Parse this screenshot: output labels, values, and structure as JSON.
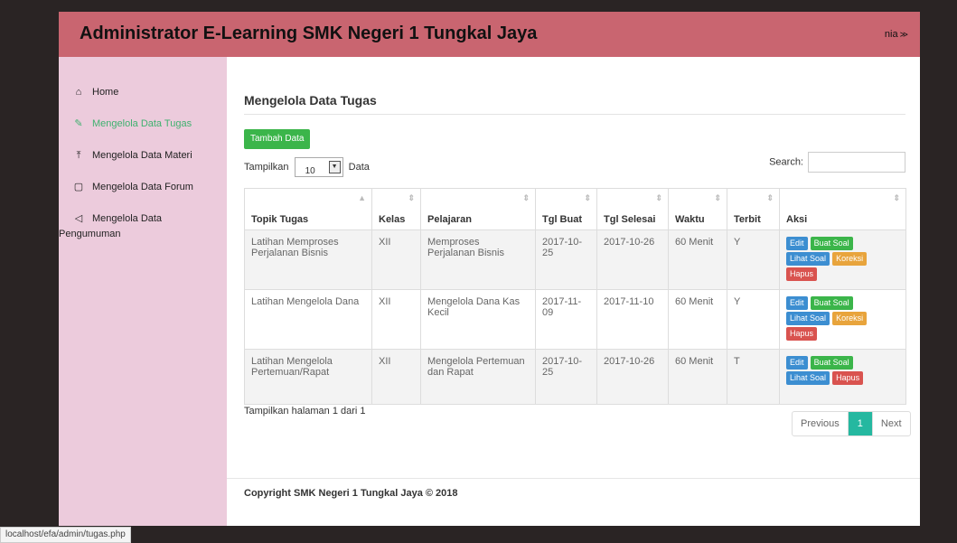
{
  "header": {
    "title": "Administrator E-Learning SMK Negeri 1 Tungkal Jaya",
    "user": "nia",
    "user_caret": "≫"
  },
  "sidebar": {
    "items": [
      {
        "label": "Home",
        "icon": "home-icon",
        "glyph": "⌂"
      },
      {
        "label": "Mengelola Data Tugas",
        "icon": "edit-icon",
        "glyph": "✎"
      },
      {
        "label": "Mengelola Data Materi",
        "icon": "upload-icon",
        "glyph": "⤒"
      },
      {
        "label": "Mengelola Data Forum",
        "icon": "chat-icon",
        "glyph": "▢"
      },
      {
        "label": "Mengelola Data",
        "label2": "Pengumuman",
        "icon": "bullhorn-icon",
        "glyph": "◁"
      }
    ]
  },
  "main": {
    "title": "Mengelola Data Tugas",
    "add_button": "Tambah Data",
    "length_prefix": "Tampilkan",
    "length_value": "10",
    "length_suffix": "Data",
    "search_label": "Search:",
    "search_value": "",
    "columns": [
      "Topik Tugas",
      "Kelas",
      "Pelajaran",
      "Tgl Buat",
      "Tgl Selesai",
      "Waktu",
      "Terbit",
      "Aksi"
    ],
    "rows": [
      {
        "topik": "Latihan Memproses Perjalanan Bisnis",
        "kelas": "XII",
        "pelajaran": "Memproses Perjalanan Bisnis",
        "tgl_buat": "2017-10-25",
        "tgl_selesai": "2017-10-26",
        "waktu": "60 Menit",
        "terbit": "Y",
        "aksi": [
          {
            "label": "Edit",
            "kind": "edit"
          },
          {
            "label": "Buat Soal",
            "kind": "buat"
          },
          {
            "label": "Lihat Soal",
            "kind": "lihat"
          },
          {
            "label": "Koreksi",
            "kind": "koreksi"
          },
          {
            "label": "Hapus",
            "kind": "hapus"
          }
        ]
      },
      {
        "topik": "Latihan Mengelola Dana",
        "kelas": "XII",
        "pelajaran": "Mengelola Dana Kas Kecil",
        "tgl_buat": "2017-11-09",
        "tgl_selesai": "2017-11-10",
        "waktu": "60 Menit",
        "terbit": "Y",
        "aksi": [
          {
            "label": "Edit",
            "kind": "edit"
          },
          {
            "label": "Buat Soal",
            "kind": "buat"
          },
          {
            "label": "Lihat Soal",
            "kind": "lihat"
          },
          {
            "label": "Koreksi",
            "kind": "koreksi"
          },
          {
            "label": "Hapus",
            "kind": "hapus"
          }
        ]
      },
      {
        "topik": "Latihan Mengelola Pertemuan/Rapat",
        "kelas": "XII",
        "pelajaran": "Mengelola Pertemuan dan Rapat",
        "tgl_buat": "2017-10-25",
        "tgl_selesai": "2017-10-26",
        "waktu": "60 Menit",
        "terbit": "T",
        "aksi": [
          {
            "label": "Edit",
            "kind": "edit"
          },
          {
            "label": "Buat Soal",
            "kind": "buat"
          },
          {
            "label": "Lihat Soal",
            "kind": "lihat"
          },
          {
            "label": "Hapus",
            "kind": "hapus"
          }
        ]
      }
    ],
    "info": "Tampilkan halaman 1 dari 1",
    "pager": {
      "prev": "Previous",
      "current": "1",
      "next": "Next"
    },
    "footer": "Copyright SMK Negeri 1 Tungkal Jaya © 2018"
  },
  "status_url": "localhost/efa/admin/tugas.php",
  "colors": {
    "header": "#c96570",
    "sidebar": "#eccbdc",
    "active_nav": "#3fb16f",
    "pager_current": "#25b8a0"
  }
}
